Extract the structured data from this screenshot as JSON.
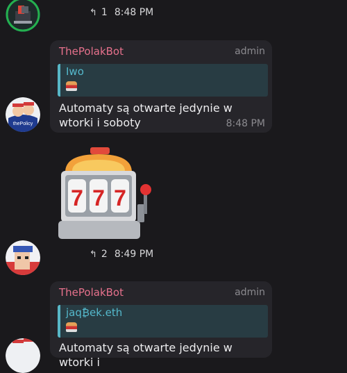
{
  "messages": [
    {
      "replies": "1",
      "time": "8:48 PM"
    },
    {
      "sender": "ThePolakBot",
      "badge": "admin",
      "quote_author": "Iwo",
      "text": "Automaty są otwarte jedynie w wtorki i soboty",
      "time": "8:48 PM",
      "avatar_text": "thePolicy"
    },
    {
      "sticker": "777",
      "replies": "2",
      "time": "8:49 PM"
    },
    {
      "sender": "ThePolakBot",
      "badge": "admin",
      "quote_author": "jaq₿ek.eth",
      "text": "Automaty są otwarte jedynie w wtorki i"
    }
  ],
  "icons": {
    "reply": "reply-arrow-icon",
    "quote_slot_machine": "slot-machine-icon"
  },
  "colors": {
    "background": "#1a191c",
    "bubble": "#26252a",
    "sender": "#e6718c",
    "quote_accent": "#58b7c7",
    "quote_bg": "#283c43",
    "meta": "#8b8a8f"
  }
}
